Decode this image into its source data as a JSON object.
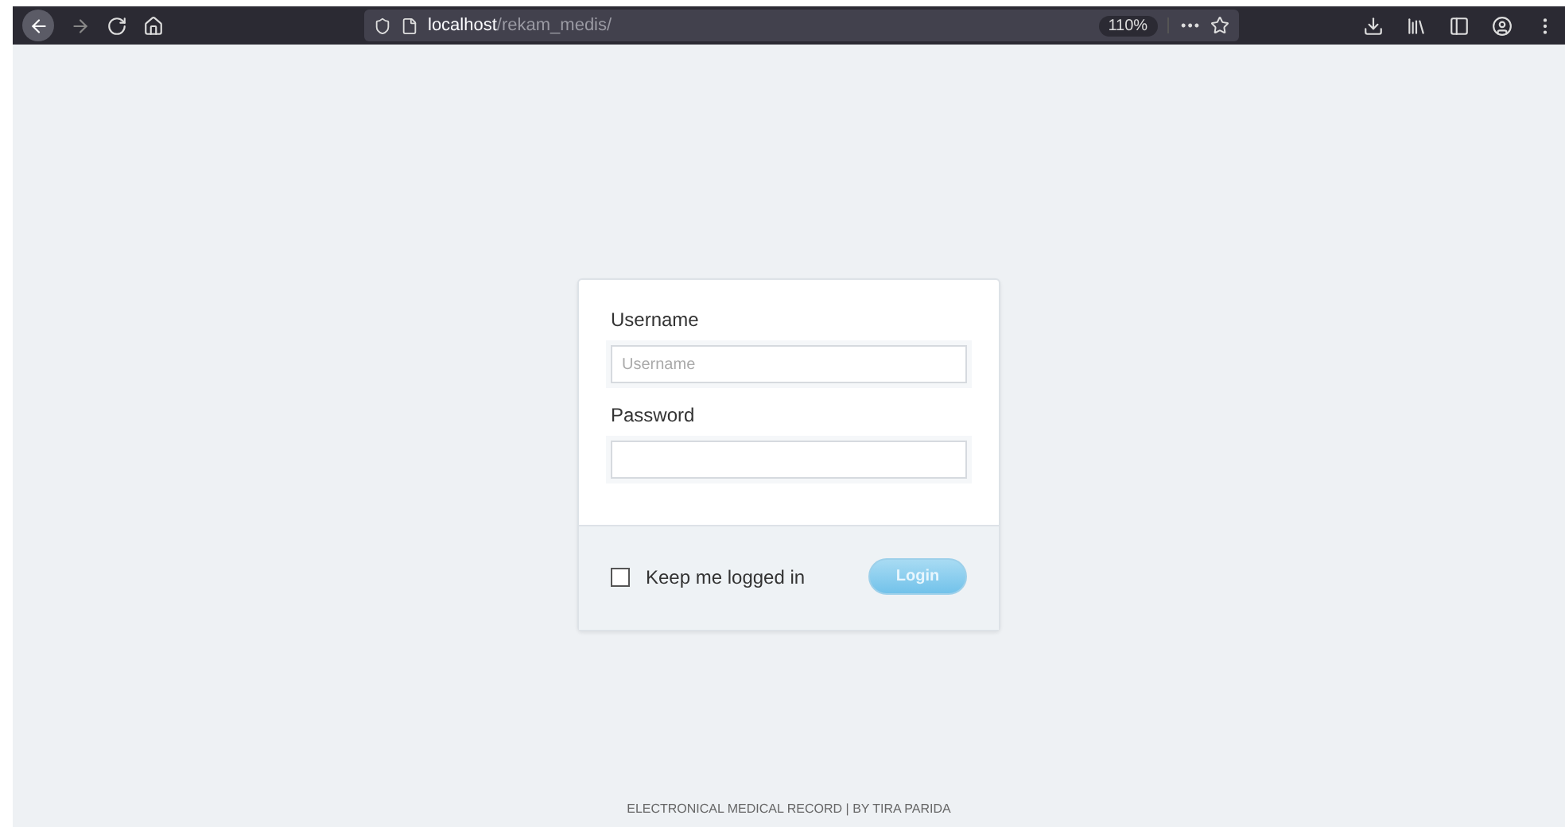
{
  "browser": {
    "url_host": "localhost",
    "url_path": "/rekam_medis/",
    "zoom": "110%",
    "menu_dots": "•••"
  },
  "login": {
    "username_label": "Username",
    "username_placeholder": "Username",
    "password_label": "Password",
    "remember_label": "Keep me logged in",
    "remember_checked": false,
    "button": "Login"
  },
  "footer": "ELECTRONICAL MEDICAL RECORD | BY TIRA PARIDA"
}
